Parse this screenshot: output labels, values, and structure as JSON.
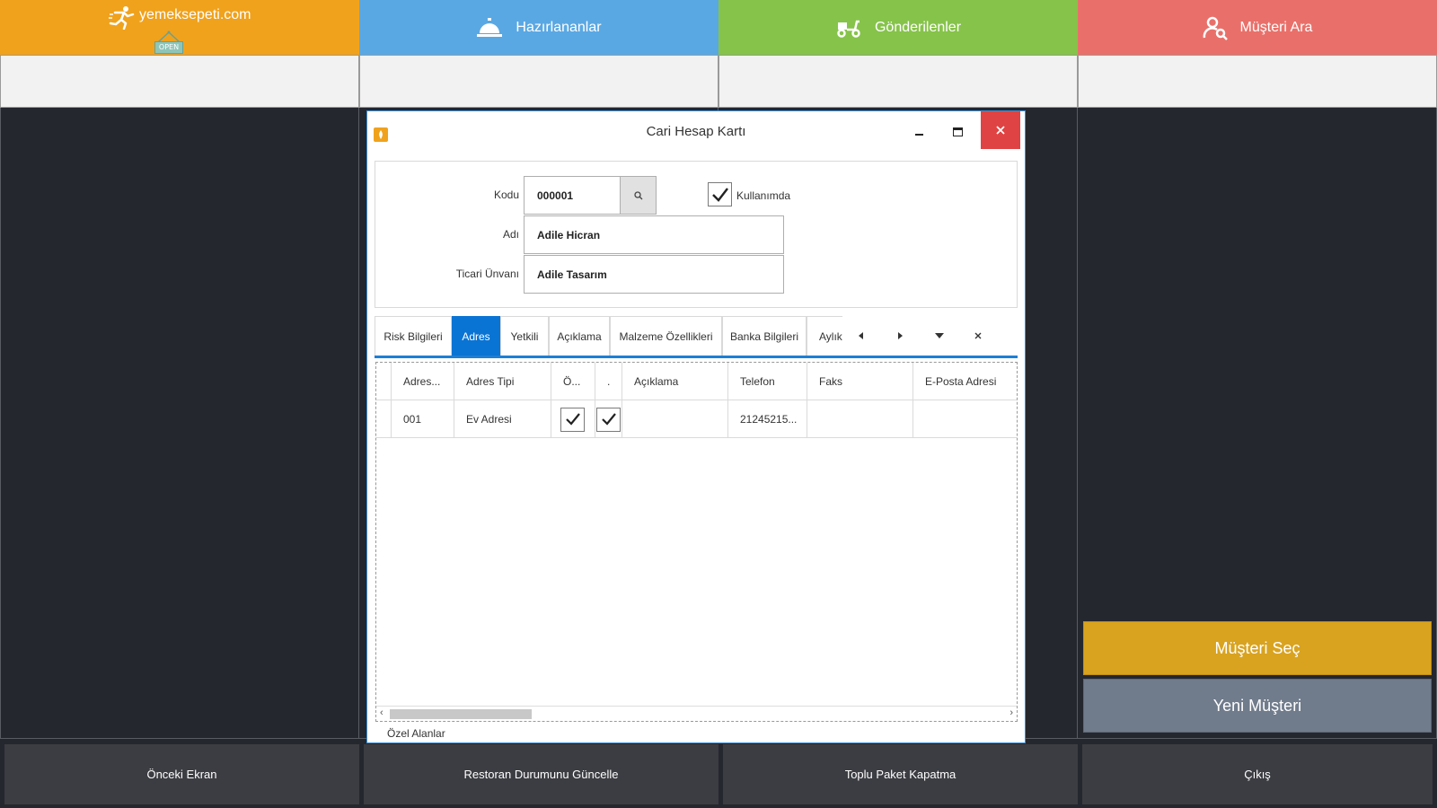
{
  "topbar": {
    "yemeksepeti_label": "yemeksepeti.com",
    "open_badge": "OPEN",
    "hazirlananlar_label": "Hazırlananlar",
    "gonderilenler_label": "Gönderilenler",
    "musteri_ara_label": "Müşteri Ara",
    "colors": {
      "yemeksepeti": "#f0a21d",
      "hazirlananlar": "#5aa8e3",
      "gonderilenler": "#86c34a",
      "musteri_ara": "#e9706a"
    }
  },
  "right_panel": {
    "musteri_sec_label": "Müşteri Seç",
    "yeni_musteri_label": "Yeni Müşteri"
  },
  "bottombar": {
    "onceki_ekran": "Önceki Ekran",
    "restoran_durumu": "Restoran Durumunu Güncelle",
    "toplu_paket": "Toplu Paket Kapatma",
    "cikis": "Çıkış"
  },
  "dialog": {
    "title": "Cari Hesap Kartı",
    "form": {
      "kodu_label": "Kodu",
      "kodu_value": "000001",
      "kullanimda_label": "Kullanımda",
      "kullanimda_checked": true,
      "adi_label": "Adı",
      "adi_value": "Adile Hicran",
      "ticari_label": "Ticari Ünvanı",
      "ticari_value": "Adile Tasarım"
    },
    "tabs": [
      "Risk Bilgileri",
      "Adres",
      "Yetkili",
      "Açıklama",
      "Malzeme Özellikleri",
      "Banka Bilgileri",
      "Aylık"
    ],
    "active_tab": "Adres",
    "grid": {
      "columns": [
        "Adres...",
        "Adres Tipi",
        "Ö...",
        ".",
        "Açıklama",
        "Telefon",
        "Faks",
        "E-Posta Adresi"
      ],
      "rows": [
        {
          "kod": "001",
          "tip": "Ev Adresi",
          "c1": true,
          "c2": true,
          "aciklama": "",
          "telefon": "21245215...",
          "faks": "",
          "eposta": ""
        }
      ]
    },
    "footer_label": "Özel Alanlar"
  }
}
